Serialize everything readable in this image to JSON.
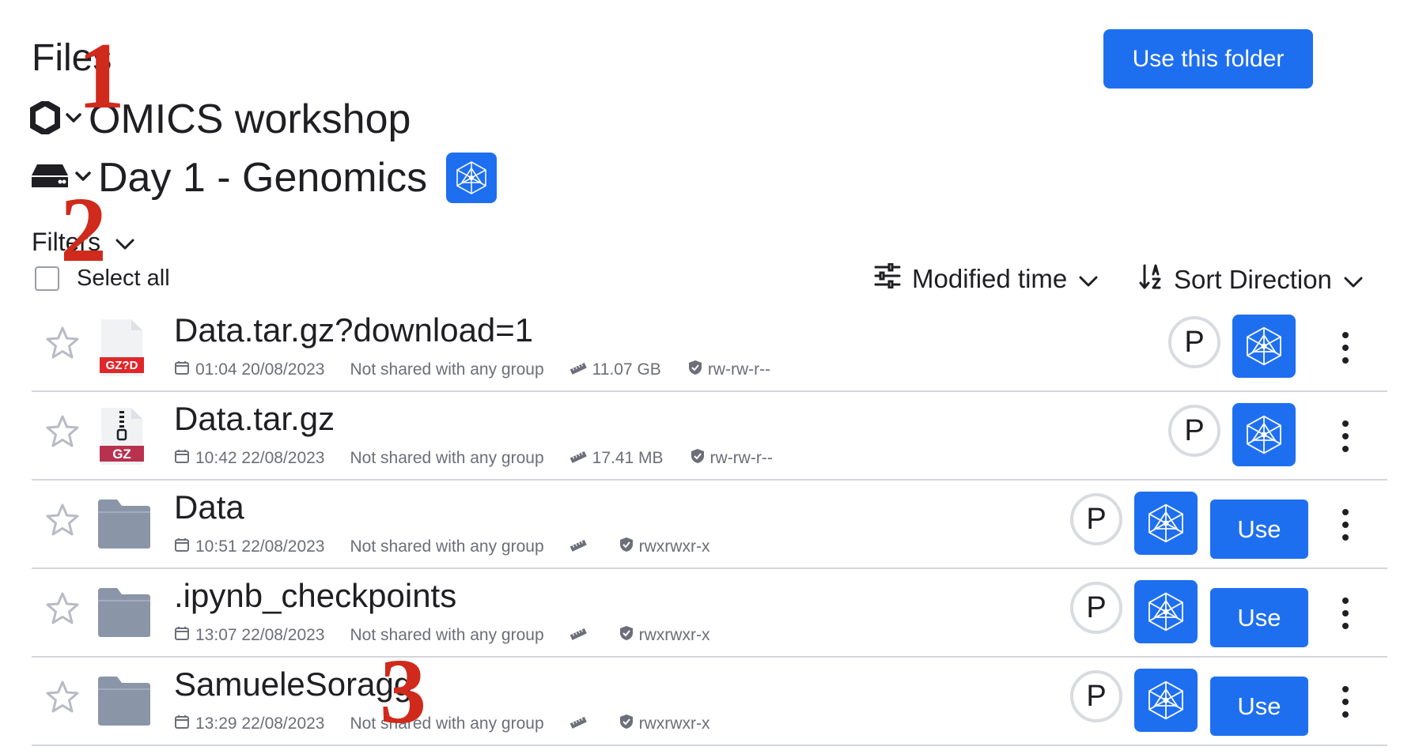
{
  "header": {
    "title": "Files",
    "use_folder_label": "Use this folder"
  },
  "breadcrumbs": {
    "project": "OMICS workshop",
    "drive": "Day 1 - Genomics"
  },
  "controls": {
    "filters_label": "Filters",
    "select_all_label": "Select all",
    "sort_by_label": "Modified time",
    "sort_direction_label": "Sort Direction"
  },
  "rows": [
    {
      "name": "Data.tar.gz?download=1",
      "type": "file",
      "ext_label": "GZ?D",
      "date": "01:04 20/08/2023",
      "share": "Not shared with any group",
      "size": "11.07 GB",
      "perm": "rw-rw-r--",
      "owner_initial": "P",
      "use_label": ""
    },
    {
      "name": "Data.tar.gz",
      "type": "archive",
      "ext_label": "GZ",
      "date": "10:42 22/08/2023",
      "share": "Not shared with any group",
      "size": "17.41 MB",
      "perm": "rw-rw-r--",
      "owner_initial": "P",
      "use_label": ""
    },
    {
      "name": "Data",
      "type": "folder",
      "ext_label": "",
      "date": "10:51 22/08/2023",
      "share": "Not shared with any group",
      "size": "",
      "perm": "rwxrwxr-x",
      "owner_initial": "P",
      "use_label": "Use"
    },
    {
      "name": ".ipynb_checkpoints",
      "type": "folder",
      "ext_label": "",
      "date": "13:07 22/08/2023",
      "share": "Not shared with any group",
      "size": "",
      "perm": "rwxrwxr-x",
      "owner_initial": "P",
      "use_label": "Use"
    },
    {
      "name": "SamueleSoragg",
      "type": "folder",
      "ext_label": "",
      "date": "13:29 22/08/2023",
      "share": "Not shared with any group",
      "size": "",
      "perm": "rwxrwxr-x",
      "owner_initial": "P",
      "use_label": "Use"
    }
  ],
  "annotations": [
    "1",
    "2",
    "3"
  ],
  "colors": {
    "accent": "#1e6ff0",
    "annotation": "#cf2a1c",
    "gz_download_label": "#e0262a",
    "gz_label": "#b8324e",
    "folder": "#8a95a8"
  },
  "icons": [
    "hexagon-icon",
    "chevron-down-icon",
    "hard-drive-icon",
    "provider-icon",
    "star-icon",
    "calendar-icon",
    "ruler-icon",
    "shield-check-icon",
    "sort-options-icon",
    "sort-direction-icon",
    "kebab-menu-icon",
    "folder-icon",
    "file-icon",
    "archive-icon"
  ]
}
